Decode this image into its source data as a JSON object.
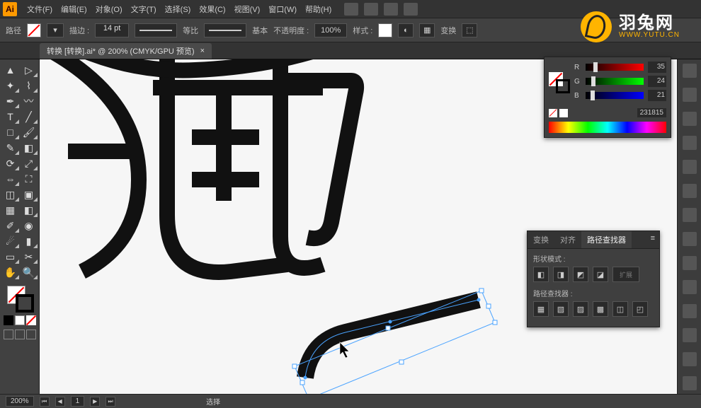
{
  "app_icon": "Ai",
  "menu": {
    "file": "文件(F)",
    "edit": "编辑(E)",
    "object": "对象(O)",
    "type": "文字(T)",
    "select": "选择(S)",
    "effect": "效果(C)",
    "view": "视图(V)",
    "window": "窗口(W)",
    "help": "帮助(H)"
  },
  "controlbar": {
    "label_main": "路径",
    "stroke_label": "描边 :",
    "stroke_weight": "14 pt",
    "profile_label": "等比",
    "style_label": "基本",
    "opacity_label": "不透明度 :",
    "opacity_value": "100%",
    "graphic_style_label": "样式 :",
    "transform_label": "变换"
  },
  "document": {
    "tab_title": "转换  [转换].ai* @ 200% (CMYK/GPU 预览)"
  },
  "color_panel": {
    "r": {
      "label": "R",
      "value": "35",
      "pos": 14
    },
    "g": {
      "label": "G",
      "value": "24",
      "pos": 10
    },
    "b": {
      "label": "B",
      "value": "21",
      "pos": 9
    },
    "hex": "231815"
  },
  "pathfinder": {
    "tab_transform": "变换",
    "tab_align": "对齐",
    "tab_pathfinder": "路径查找器",
    "shape_modes_label": "形状模式 :",
    "expand_label": "扩展",
    "pathfinders_label": "路径查找器 :"
  },
  "statusbar": {
    "zoom": "200%",
    "page": "1",
    "tool": "选择"
  },
  "watermark": {
    "cn": "羽兔网",
    "en": "WWW.YUTU.CN"
  }
}
